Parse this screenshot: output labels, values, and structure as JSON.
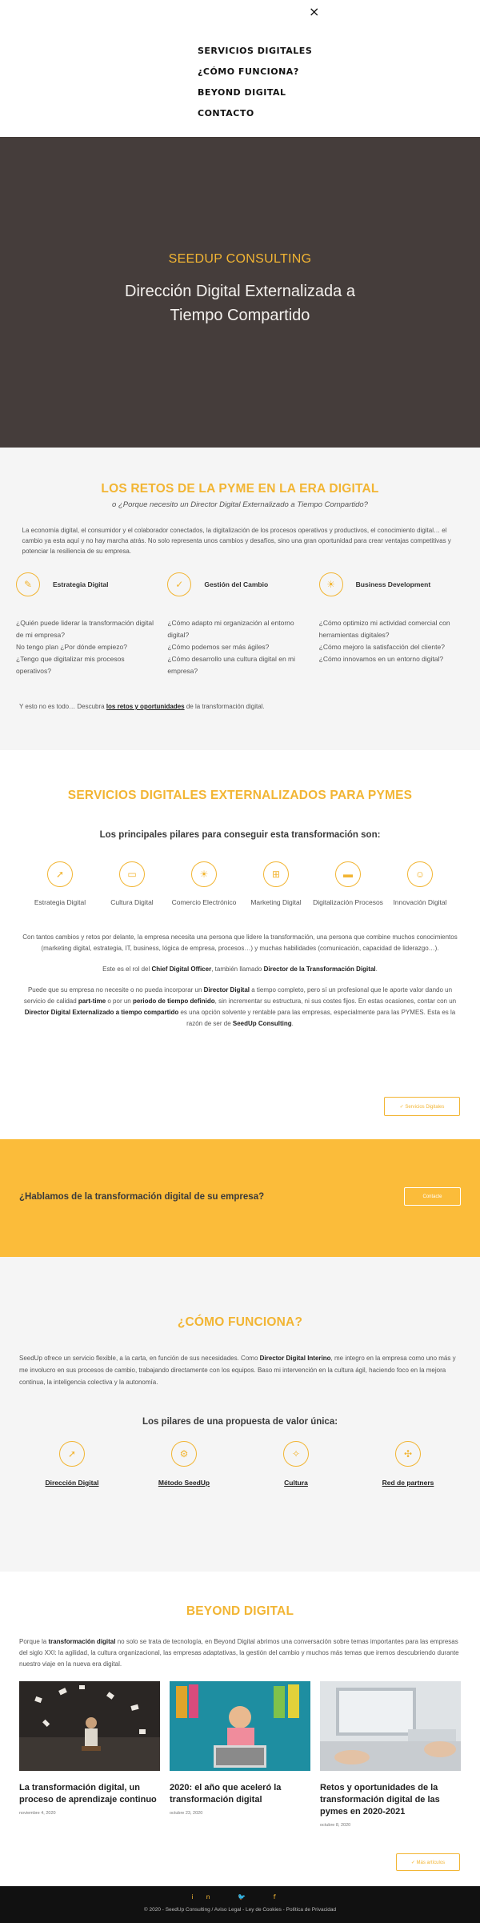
{
  "nav": {
    "close_icon": "×",
    "items": [
      "SERVICIOS DIGITALES",
      "¿CÓMO FUNCIONA?",
      "BEYOND DIGITAL",
      "CONTACTO"
    ]
  },
  "hero": {
    "brand": "SEEDUP CONSULTING",
    "title": "Dirección Digital Externalizada a Tiempo Compartido"
  },
  "retos": {
    "title": "LOS RETOS DE LA PYME EN LA ERA DIGITAL",
    "subtitle": "o ¿Porque necesito un Director Digital Externalizado a Tiempo Compartido?",
    "intro": "La economía digital, el consumidor y el colaborador conectados, la digitalización de los procesos operativos y productivos, el conocimiento digital… el cambio ya esta aquí y no hay marcha atrás. No solo representa unos cambios y desafíos, sino una gran oportunidad para crear ventajas competitivas y potenciar la resiliencia de su empresa.",
    "pillars": [
      {
        "icon": "megaphone-icon",
        "glyph": "✎",
        "label": "Estrategia Digital",
        "lines": [
          "¿Quién puede liderar la transformación digital de mi empresa?",
          "No tengo plan ¿Por dónde empiezo?",
          "¿Tengo que digitalizar mis procesos operativos?"
        ]
      },
      {
        "icon": "check-icon",
        "glyph": "✓",
        "label": "Gestión del Cambio",
        "lines": [
          "¿Cómo adapto mi organización al entorno digital?",
          "¿Cómo podemos ser más ágiles?",
          "¿Cómo desarrollo una cultura digital en mi empresa?"
        ]
      },
      {
        "icon": "lightbulb-icon",
        "glyph": "☀",
        "label": "Business Development",
        "lines": [
          "¿Cómo optimizo mi actividad comercial con herramientas digitales?",
          "¿Cómo mejoro la satisfacción del cliente?",
          "¿Cómo innovamos en un entorno digital?"
        ]
      }
    ],
    "outro_pre": "Y esto no es todo… Descubra ",
    "outro_link": "los retos y oportunidades",
    "outro_post": " de la transformación digital."
  },
  "servicios": {
    "title": "SERVICIOS DIGITALES EXTERNALIZADOS PARA PYMES",
    "subtitle": "Los principales pilares para conseguir esta transformación son:",
    "pillars": [
      {
        "icon": "rocket-icon",
        "glyph": "➚",
        "label": "Estrategia Digital"
      },
      {
        "icon": "bus-icon",
        "glyph": "▭",
        "label": "Cultura Digital"
      },
      {
        "icon": "lightbulb-icon",
        "glyph": "☀",
        "label": "Comercio Electrónico"
      },
      {
        "icon": "cart-icon",
        "glyph": "⊞",
        "label": "Marketing Digital"
      },
      {
        "icon": "laptop-icon",
        "glyph": "▬",
        "label": "Digitalización Procesos"
      },
      {
        "icon": "people-icon",
        "glyph": "☺",
        "label": "Innovación Digital"
      }
    ],
    "p1": "Con tantos cambios y retos por delante, la empresa necesita una persona que lidere la transformación, una persona que combine muchos conocimientos (marketing digital, estrategia, IT, business, lógica de empresa, procesos…) y muchas habilidades (comunicación, capacidad de liderazgo…).",
    "p2_pre": "Este es el rol del ",
    "p2_b1": "Chief Digital Officer",
    "p2_mid": ", también llamado ",
    "p2_b2": "Director de la Transformación Digital",
    "p2_post": ".",
    "p3_a": "Puede que su empresa no necesite o no pueda incorporar un ",
    "p3_b1": "Director Digital",
    "p3_b": " a tiempo completo, pero sí un profesional que le aporte valor dando un servicio de calidad ",
    "p3_b2": "part-time",
    "p3_c": " o por un ",
    "p3_b3": "periodo de tiempo definido",
    "p3_d": ", sin incrementar su estructura, ni sus costes fijos. En estas ocasiones, contar con un ",
    "p3_b4": "Director Digital Externalizado a tiempo compartido",
    "p3_e": " es una opción solvente y rentable para las empresas, especialmente para las PYMES. Esta es la razón de ser de ",
    "p3_b5": "SeedUp Consulting",
    "p3_f": ".",
    "button": "✓ Servicios Digitales"
  },
  "cta": {
    "text": "¿Hablamos de la transformación digital de su empresa?",
    "button": "Contacte"
  },
  "como": {
    "title": "¿CÓMO FUNCIONA?",
    "body_a": "SeedUp ofrece un servicio flexible, a la carta, en función de sus necesidades. Como ",
    "body_b": "Director Digital Interino",
    "body_c": ", me integro en la empresa como uno más y me involucro en sus procesos de cambio, trabajando directamente con los equipos. Baso mi intervención en la cultura ágil, haciendo foco en la mejora continua, la inteligencia colectiva y la autonomía.",
    "subtitle": "Los pilares de una propuesta de valor única:",
    "pillars": [
      {
        "icon": "rocket-icon",
        "glyph": "➚",
        "label": "Dirección Digital"
      },
      {
        "icon": "gear-icon",
        "glyph": "⚙",
        "label": "Método SeedUp"
      },
      {
        "icon": "compass-icon",
        "glyph": "✧",
        "label": "Cultura"
      },
      {
        "icon": "network-icon",
        "glyph": "✣",
        "label": "Red de partners"
      }
    ]
  },
  "beyond": {
    "title": "BEYOND DIGITAL",
    "body_a": "Porque la ",
    "body_b": "transformación digital",
    "body_c": " no solo se trata de tecnología, en Beyond Digital abrimos una conversación sobre temas importantes para las empresas del siglo XXI: la agilidad, la cultura organizacional, las empresas adaptativas, la gestión del cambio y muchos más temas que iremos descubriendo durante nuestro viaje en la nueva era digital.",
    "posts": [
      {
        "title": "La transformación digital, un proceso de aprendizaje continuo",
        "date": "noviembre 4, 2020"
      },
      {
        "title": "2020: el año que aceleró la transformación digital",
        "date": "octubre 23, 2020"
      },
      {
        "title": "Retos y oportunidades de la transformación digital de las pymes en 2020-2021",
        "date": "octubre 8, 2020"
      }
    ],
    "button": "✓ Más artículos"
  },
  "footer": {
    "social": [
      "in",
      "🐦",
      "f"
    ],
    "legal": "© 2020 - SeedUp Consulting / Aviso Legal - Ley de Cookies - Política de Privacidad"
  },
  "colors": {
    "accent": "#f2b533",
    "hero_bg": "#453d3b",
    "cta_bg": "#fbbc3a",
    "footer_bg": "#111111"
  }
}
